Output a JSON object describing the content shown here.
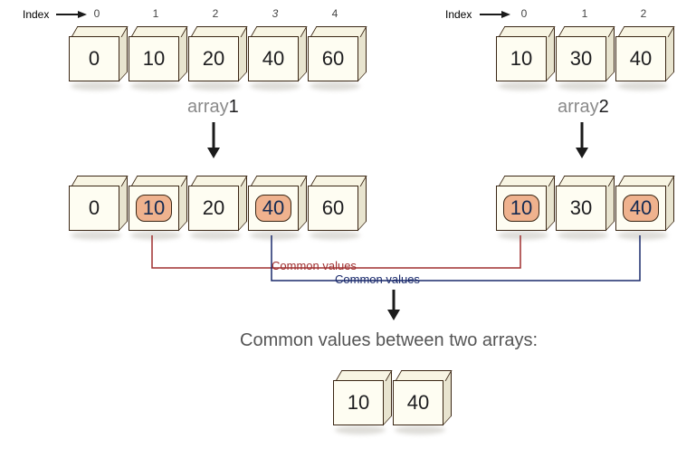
{
  "index_label": "Index",
  "array1": {
    "name_prefix": "array",
    "name_num": "1",
    "indices": [
      "0",
      "1",
      "2",
      "3",
      "4"
    ],
    "values": [
      "0",
      "10",
      "20",
      "40",
      "60"
    ]
  },
  "array2": {
    "name_prefix": "array",
    "name_num": "2",
    "indices": [
      "0",
      "1",
      "2"
    ],
    "values": [
      "10",
      "30",
      "40"
    ]
  },
  "row2_array1": {
    "values": [
      "0",
      "10",
      "20",
      "40",
      "60"
    ],
    "highlighted": [
      false,
      true,
      false,
      true,
      false
    ]
  },
  "row2_array2": {
    "values": [
      "10",
      "30",
      "40"
    ],
    "highlighted": [
      true,
      false,
      true
    ]
  },
  "connector_label_red": "Common values",
  "connector_label_blue": "Common values",
  "result_caption": "Common values between two arrays:",
  "result_values": [
    "10",
    "40"
  ]
}
